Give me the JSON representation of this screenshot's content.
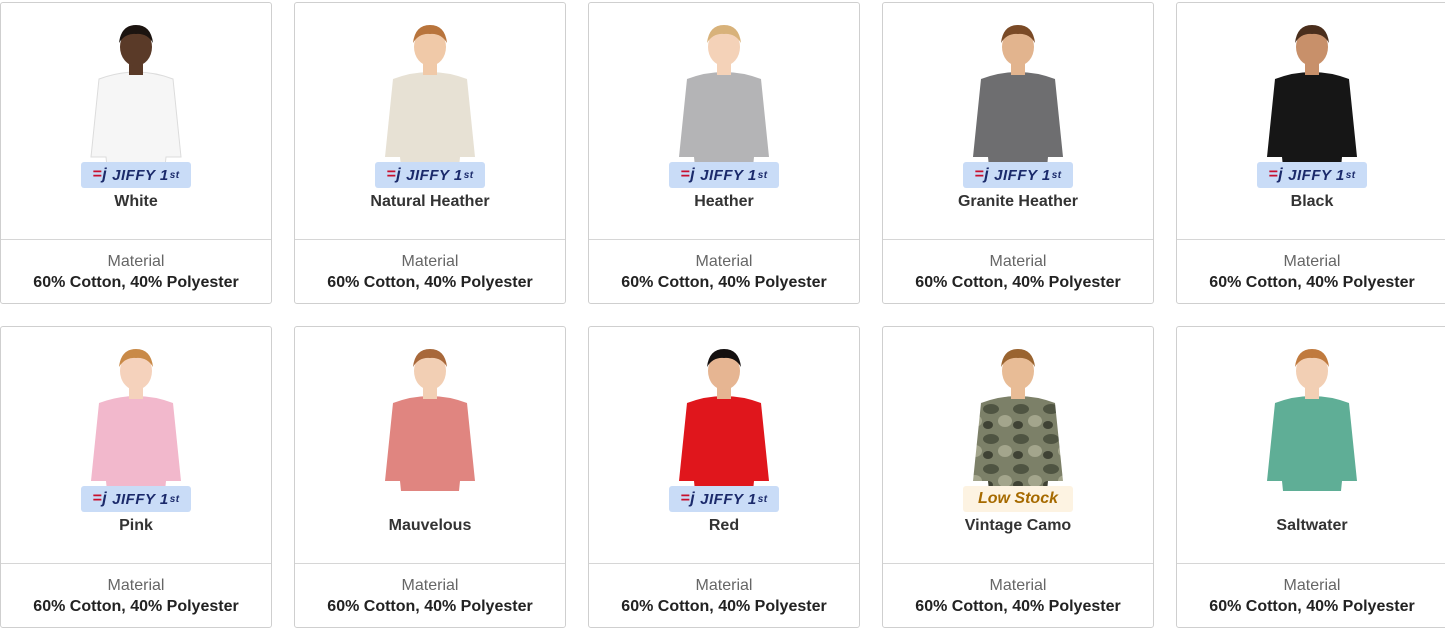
{
  "swatches": [
    {
      "name": "White",
      "badge": "jiffy",
      "material_label": "Material",
      "material_value": "60% Cotton, 40% Polyester",
      "shirt_color": "#f6f6f6",
      "skin": "#5a3a28",
      "hair": "#1c1410"
    },
    {
      "name": "Natural Heather",
      "badge": "jiffy",
      "material_label": "Material",
      "material_value": "60% Cotton, 40% Polyester",
      "shirt_color": "#e7e1d4",
      "skin": "#f0c9a8",
      "hair": "#b8743c"
    },
    {
      "name": "Heather",
      "badge": "jiffy",
      "material_label": "Material",
      "material_value": "60% Cotton, 40% Polyester",
      "shirt_color": "#b4b4b6",
      "skin": "#f4d2b8",
      "hair": "#d8b27a"
    },
    {
      "name": "Granite Heather",
      "badge": "jiffy",
      "material_label": "Material",
      "material_value": "60% Cotton, 40% Polyester",
      "shirt_color": "#6e6e70",
      "skin": "#e2b48e",
      "hair": "#7a4a26"
    },
    {
      "name": "Black",
      "badge": "jiffy",
      "material_label": "Material",
      "material_value": "60% Cotton, 40% Polyester",
      "shirt_color": "#161616",
      "skin": "#c8906a",
      "hair": "#4a2e1c"
    },
    {
      "name": "Pink",
      "badge": "jiffy",
      "material_label": "Material",
      "material_value": "60% Cotton, 40% Polyester",
      "shirt_color": "#f2b8cc",
      "skin": "#f5d2bc",
      "hair": "#c98a48"
    },
    {
      "name": "Mauvelous",
      "badge": "none",
      "material_label": "Material",
      "material_value": "60% Cotton, 40% Polyester",
      "shirt_color": "#e08580",
      "skin": "#f2cfb4",
      "hair": "#a8683a"
    },
    {
      "name": "Red",
      "badge": "jiffy",
      "material_label": "Material",
      "material_value": "60% Cotton, 40% Polyester",
      "shirt_color": "#e0161c",
      "skin": "#e6b592",
      "hair": "#141010"
    },
    {
      "name": "Vintage Camo",
      "badge": "lowstock",
      "material_label": "Material",
      "material_value": "60% Cotton, 40% Polyester",
      "shirt_color": "#6a6e58",
      "skin": "#e8bc96",
      "hair": "#9a6430"
    },
    {
      "name": "Saltwater",
      "badge": "none",
      "material_label": "Material",
      "material_value": "60% Cotton, 40% Polyester",
      "shirt_color": "#5fae96",
      "skin": "#f2cfb4",
      "hair": "#c07a3e"
    }
  ],
  "badge_jiffy": {
    "text": "JIFFY 1",
    "sup": "st"
  },
  "badge_lowstock": {
    "text": "Low Stock"
  }
}
